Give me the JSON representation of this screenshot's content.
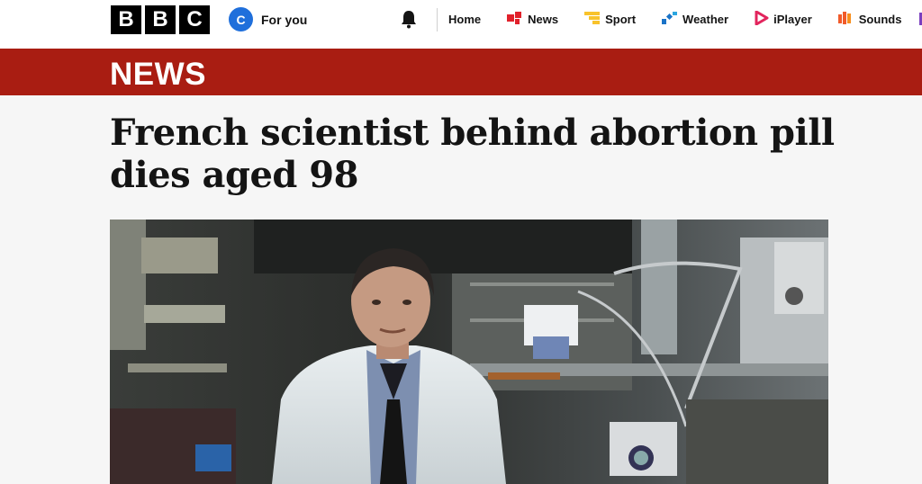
{
  "header": {
    "logo_letters": [
      "B",
      "B",
      "C"
    ],
    "account": {
      "badge": "C",
      "label": "For you"
    },
    "nav": [
      {
        "label": "Home",
        "icon": "none"
      },
      {
        "label": "News",
        "icon": "news-icon",
        "color": "#e1212b"
      },
      {
        "label": "Sport",
        "icon": "sport-icon",
        "color": "#f8c32b"
      },
      {
        "label": "Weather",
        "icon": "weather-icon",
        "color": "#1a73c7"
      },
      {
        "label": "iPlayer",
        "icon": "iplayer-icon",
        "color": "#e2255d"
      },
      {
        "label": "Sounds",
        "icon": "sounds-icon",
        "color": "#f15b2a"
      }
    ]
  },
  "section": {
    "title": "NEWS",
    "color": "#a91d12"
  },
  "article": {
    "headline": "French scientist behind abortion pill dies aged 98",
    "image_subject": "scientist in white lab coat in a laboratory"
  }
}
